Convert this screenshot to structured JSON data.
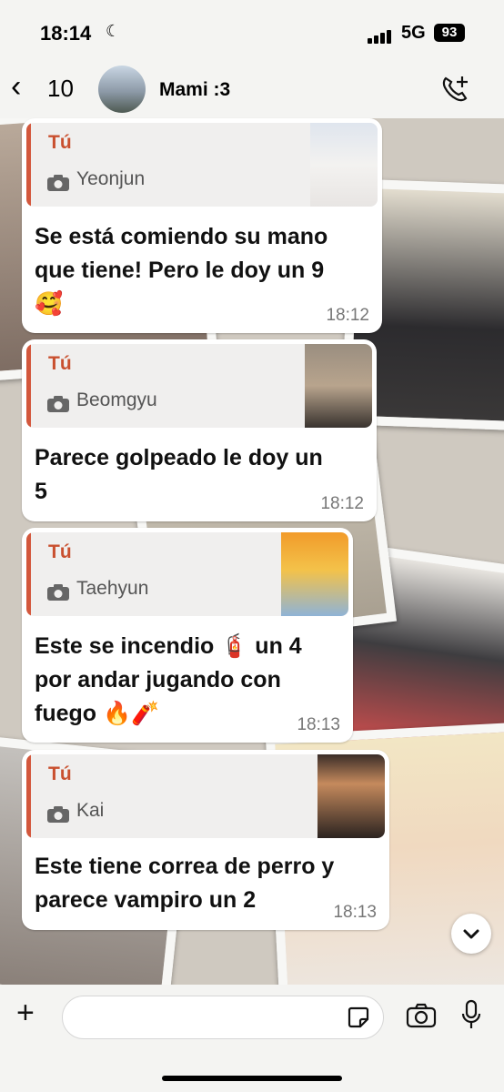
{
  "status_bar": {
    "time": "18:14",
    "network": "5G",
    "battery": "93"
  },
  "header": {
    "back_count": "10",
    "contact_name": "Mami :3"
  },
  "messages": [
    {
      "quote_author": "Tú",
      "quote_text": "Yeonjun",
      "text": "Se está comiendo su mano\nque tiene! Pero le doy un 9\n🥰",
      "time": "18:12"
    },
    {
      "quote_author": "Tú",
      "quote_text": "Beomgyu",
      "text": "Parece golpeado le doy un\n5",
      "time": "18:12"
    },
    {
      "quote_author": "Tú",
      "quote_text": "Taehyun",
      "text": "Este se incendio 🧯 un 4\npor andar jugando con\nfuego 🔥🧨",
      "time": "18:13"
    },
    {
      "quote_author": "Tú",
      "quote_text": "Kai",
      "text": "Este tiene correa de perro y\nparece vampiro un 2",
      "time": "18:13"
    }
  ],
  "icons": {
    "back": "chevron-left-icon",
    "call": "phone-add-icon",
    "camera": "camera-icon",
    "mic": "microphone-icon",
    "sticker": "sticker-icon",
    "plus": "plus-icon",
    "scroll": "chevron-down-icon"
  },
  "colors": {
    "quote_accent": "#d3573c",
    "bubble": "#ffffff",
    "bar": "#f4f4f2"
  }
}
